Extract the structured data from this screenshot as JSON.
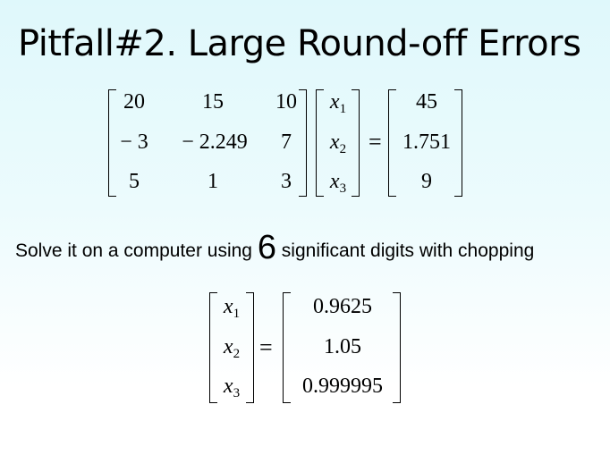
{
  "title": "Pitfall#2. Large Round-off Errors",
  "system": {
    "A": [
      [
        "20",
        "15",
        "10"
      ],
      [
        "− 3",
        "− 2.249",
        "7"
      ],
      [
        "5",
        "1",
        "3"
      ]
    ],
    "x": [
      {
        "sym": "x",
        "sub": "1"
      },
      {
        "sym": "x",
        "sub": "2"
      },
      {
        "sym": "x",
        "sub": "3"
      }
    ],
    "equals": "=",
    "b": [
      "45",
      "1.751",
      "9"
    ]
  },
  "instruction": {
    "before": "Solve it on a computer using ",
    "digits": "6",
    "after": " significant digits with chopping"
  },
  "solution": {
    "x": [
      {
        "sym": "x",
        "sub": "1"
      },
      {
        "sym": "x",
        "sub": "2"
      },
      {
        "sym": "x",
        "sub": "3"
      }
    ],
    "equals": "=",
    "values": [
      "0.9625",
      "1.05",
      "0.999995"
    ]
  }
}
